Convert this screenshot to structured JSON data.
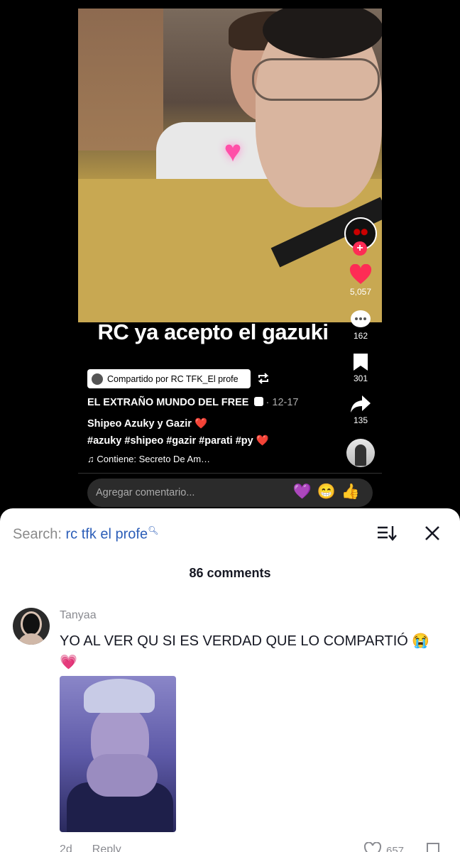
{
  "video": {
    "caption": "RC ya acepto el gazuki",
    "sticker": "heart-sticker",
    "shared_by": "Compartido por RC TFK_El profe",
    "account": "EL EXTRAÑO MUNDO DEL FREE",
    "date": "· 12-17",
    "title": "Shipeo Azuky y Gazir ❤️",
    "hashtags": "#azuky #shipeo #gazir #parati #py ❤️",
    "music": "♫ Contiene: Secreto De Am…",
    "comment_placeholder": "Agregar comentario...",
    "comment_emojis": "💜😁👍"
  },
  "rail": {
    "likes": "5,057",
    "comments": "162",
    "saves": "301",
    "shares": "135",
    "like_color": "#fe2c55"
  },
  "sheet": {
    "search_prefix": "Search: ",
    "search_query": "rc tfk el profe",
    "comment_count": "86 comments"
  },
  "comment": {
    "username": "Tanyaa",
    "text": "YO AL VER QU SI ES VERDAD QUE LO COMPARTIÓ 😭💗",
    "age": "2d",
    "reply_label": "Reply",
    "likes": "657"
  }
}
